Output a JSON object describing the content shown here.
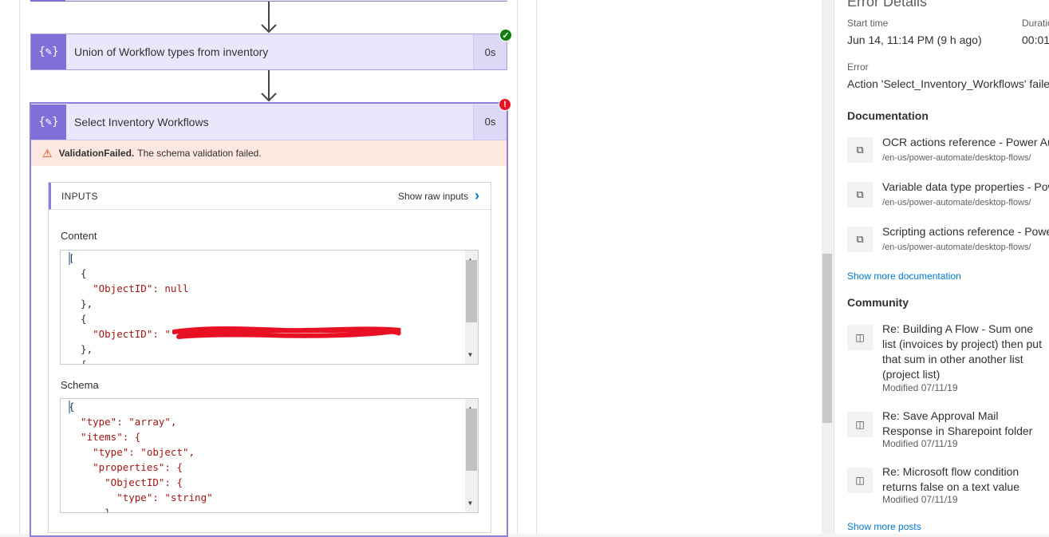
{
  "flow": {
    "step1": {
      "title": "Union of Workflow types from inventory",
      "duration": "0s",
      "status": "succeeded",
      "icon": "compose-icon"
    },
    "step2": {
      "title": "Select Inventory Workflows",
      "duration": "0s",
      "status": "failed",
      "icon": "compose-icon",
      "error_code": "ValidationFailed.",
      "error_message": "The schema validation failed.",
      "inputs": {
        "header": "INPUTS",
        "show_raw": "Show raw inputs",
        "content_label": "Content",
        "content_lines": [
          "[",
          "  {",
          "    \"ObjectID\": null",
          "  },",
          "  {",
          "    \"ObjectID\": \"",
          "  },",
          "  {"
        ],
        "schema_label": "Schema",
        "schema_lines": [
          "{",
          "  \"type\": \"array\",",
          "  \"items\": {",
          "    \"type\": \"object\",",
          "    \"properties\": {",
          "      \"ObjectID\": {",
          "        \"type\": \"string\"",
          "      }"
        ]
      }
    }
  },
  "details": {
    "title": "Error Details",
    "start_time_label": "Start time",
    "start_time_value": "Jun 14, 11:14 PM (9 h ago)",
    "duration_label": "Duratio",
    "duration_value": "00:01:",
    "error_label": "Error",
    "error_value": "Action 'Select_Inventory_Workflows' failed",
    "documentation_heading": "Documentation",
    "docs": [
      {
        "title": "OCR actions reference - Power Au",
        "path": "/en-us/power-automate/desktop-flows/"
      },
      {
        "title": "Variable data type properties - Pow",
        "path": "/en-us/power-automate/desktop-flows/"
      },
      {
        "title": "Scripting actions reference - Powe",
        "path": "/en-us/power-automate/desktop-flows/"
      }
    ],
    "show_more_docs": "Show more documentation",
    "community_heading": "Community",
    "posts": [
      {
        "title": "Re: Building A Flow - Sum one list (invoices by project) then put that sum in other another list (project list)",
        "modified": "Modified 07/11/19"
      },
      {
        "title": "Re: Save Approval Mail Response in Sharepoint folder",
        "modified": "Modified 07/11/19"
      },
      {
        "title": "Re: Microsoft flow condition returns false on a text value",
        "modified": "Modified 07/11/19"
      }
    ],
    "show_more_posts": "Show more posts"
  },
  "colors": {
    "accent": "#7f70d8",
    "error": "#e81123",
    "success": "#107c10",
    "link": "#0078d4"
  }
}
